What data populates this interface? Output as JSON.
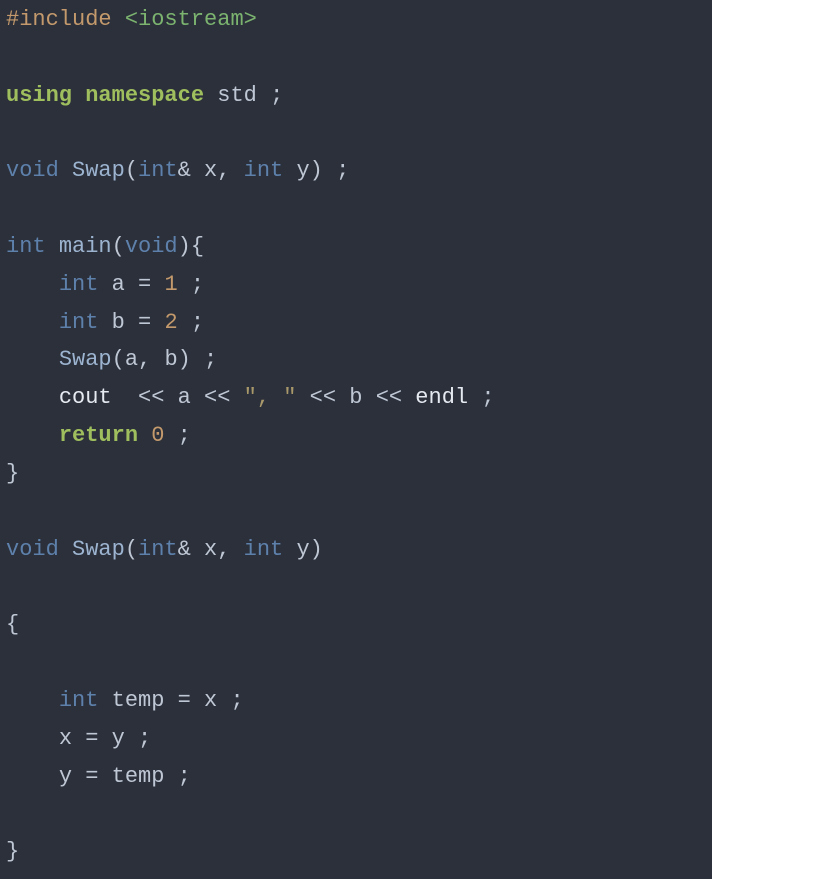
{
  "language": "cpp",
  "code": {
    "include_keyword": "#include",
    "include_header": "<iostream>",
    "using": "using",
    "namespace": "namespace",
    "std": "std",
    "semicolon": ";",
    "void": "void",
    "int": "int",
    "swap_fn": "Swap",
    "main_fn": "main",
    "amp": "&",
    "x": "x",
    "y": "y",
    "a": "a",
    "b": "b",
    "temp": "temp",
    "lparen": "(",
    "rparen": ")",
    "lbrace": "{",
    "rbrace": "}",
    "comma": ",",
    "eq": "=",
    "one": "1",
    "two": "2",
    "zero": "0",
    "cout": "cout",
    "endl": "endl",
    "ins_op": "<<",
    "str_sep": "\", \"",
    "return": "return"
  }
}
